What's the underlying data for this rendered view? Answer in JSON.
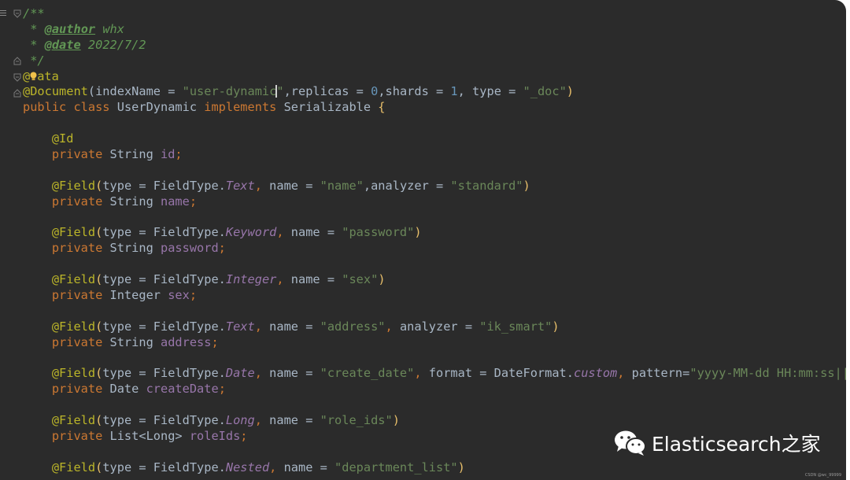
{
  "editor": {
    "language": "java",
    "theme_colors": {
      "background": "#2b2b2b",
      "default_text": "#a9b7c6",
      "keyword": "#cc7832",
      "annotation": "#bbb529",
      "string": "#6a8759",
      "number": "#6897bb",
      "field": "#9876aa",
      "doc_comment": "#629755"
    },
    "lines": [
      {
        "tokens": [
          {
            "t": "/**",
            "c": "doc"
          }
        ]
      },
      {
        "tokens": [
          {
            "t": " * ",
            "c": "doc"
          },
          {
            "t": "@author",
            "c": "doctag"
          },
          {
            "t": " whx",
            "c": "doc"
          }
        ]
      },
      {
        "tokens": [
          {
            "t": " * ",
            "c": "doc"
          },
          {
            "t": "@date",
            "c": "doctag"
          },
          {
            "t": " 2022/7/2",
            "c": "doc"
          }
        ]
      },
      {
        "tokens": [
          {
            "t": " */",
            "c": "doc"
          }
        ]
      },
      {
        "tokens": [
          {
            "t": "@",
            "c": "ann"
          },
          {
            "t": "",
            "c": "bulb"
          },
          {
            "t": "ata",
            "c": "ann"
          }
        ]
      },
      {
        "tokens": [
          {
            "t": "@Document",
            "c": "ann"
          },
          {
            "t": "(indexName = ",
            "c": "param"
          },
          {
            "t": "\"user-dynamic",
            "c": "str"
          },
          {
            "t": "",
            "c": "cursor"
          },
          {
            "t": "\"",
            "c": "str"
          },
          {
            "t": ",replicas = ",
            "c": "param"
          },
          {
            "t": "0",
            "c": "num"
          },
          {
            "t": ",shards = ",
            "c": "param"
          },
          {
            "t": "1",
            "c": "num"
          },
          {
            "t": ", type = ",
            "c": "param"
          },
          {
            "t": "\"_doc\"",
            "c": "str"
          },
          {
            "t": ")",
            "c": "brace"
          }
        ]
      },
      {
        "tokens": [
          {
            "t": "public class ",
            "c": "kw"
          },
          {
            "t": "UserDynamic ",
            "c": "param"
          },
          {
            "t": "implements ",
            "c": "kw"
          },
          {
            "t": "Serializable ",
            "c": "param"
          },
          {
            "t": "{",
            "c": "brace"
          }
        ]
      },
      {
        "tokens": []
      },
      {
        "tokens": [
          {
            "t": "    @Id",
            "c": "ann"
          }
        ]
      },
      {
        "tokens": [
          {
            "t": "    private ",
            "c": "kw"
          },
          {
            "t": "String ",
            "c": "param"
          },
          {
            "t": "id",
            "c": "field"
          },
          {
            "t": ";",
            "c": "kw"
          }
        ]
      },
      {
        "tokens": []
      },
      {
        "tokens": [
          {
            "t": "    @Field",
            "c": "ann"
          },
          {
            "t": "(",
            "c": "brace"
          },
          {
            "t": "type = FieldType.",
            "c": "param"
          },
          {
            "t": "Text",
            "c": "enum"
          },
          {
            "t": ", ",
            "c": "kw"
          },
          {
            "t": "name = ",
            "c": "param"
          },
          {
            "t": "\"name\"",
            "c": "str"
          },
          {
            "t": ",analyzer = ",
            "c": "param"
          },
          {
            "t": "\"standard\"",
            "c": "str"
          },
          {
            "t": ")",
            "c": "brace"
          }
        ]
      },
      {
        "tokens": [
          {
            "t": "    private ",
            "c": "kw"
          },
          {
            "t": "String ",
            "c": "param"
          },
          {
            "t": "name",
            "c": "field"
          },
          {
            "t": ";",
            "c": "kw"
          }
        ]
      },
      {
        "tokens": []
      },
      {
        "tokens": [
          {
            "t": "    @Field",
            "c": "ann"
          },
          {
            "t": "(",
            "c": "brace"
          },
          {
            "t": "type = FieldType.",
            "c": "param"
          },
          {
            "t": "Keyword",
            "c": "enum"
          },
          {
            "t": ", ",
            "c": "kw"
          },
          {
            "t": "name = ",
            "c": "param"
          },
          {
            "t": "\"password\"",
            "c": "str"
          },
          {
            "t": ")",
            "c": "brace"
          }
        ]
      },
      {
        "tokens": [
          {
            "t": "    private ",
            "c": "kw"
          },
          {
            "t": "String ",
            "c": "param"
          },
          {
            "t": "password",
            "c": "field"
          },
          {
            "t": ";",
            "c": "kw"
          }
        ]
      },
      {
        "tokens": []
      },
      {
        "tokens": [
          {
            "t": "    @Field",
            "c": "ann"
          },
          {
            "t": "(",
            "c": "brace"
          },
          {
            "t": "type = FieldType.",
            "c": "param"
          },
          {
            "t": "Integer",
            "c": "enum"
          },
          {
            "t": ", ",
            "c": "kw"
          },
          {
            "t": "name = ",
            "c": "param"
          },
          {
            "t": "\"sex\"",
            "c": "str"
          },
          {
            "t": ")",
            "c": "brace"
          }
        ]
      },
      {
        "tokens": [
          {
            "t": "    private ",
            "c": "kw"
          },
          {
            "t": "Integer ",
            "c": "param"
          },
          {
            "t": "sex",
            "c": "field"
          },
          {
            "t": ";",
            "c": "kw"
          }
        ]
      },
      {
        "tokens": []
      },
      {
        "tokens": [
          {
            "t": "    @Field",
            "c": "ann"
          },
          {
            "t": "(",
            "c": "brace"
          },
          {
            "t": "type = FieldType.",
            "c": "param"
          },
          {
            "t": "Text",
            "c": "enum"
          },
          {
            "t": ", ",
            "c": "kw"
          },
          {
            "t": "name = ",
            "c": "param"
          },
          {
            "t": "\"address\"",
            "c": "str"
          },
          {
            "t": ", ",
            "c": "kw"
          },
          {
            "t": "analyzer = ",
            "c": "param"
          },
          {
            "t": "\"ik_smart\"",
            "c": "str"
          },
          {
            "t": ")",
            "c": "brace"
          }
        ]
      },
      {
        "tokens": [
          {
            "t": "    private ",
            "c": "kw"
          },
          {
            "t": "String ",
            "c": "param"
          },
          {
            "t": "address",
            "c": "field"
          },
          {
            "t": ";",
            "c": "kw"
          }
        ]
      },
      {
        "tokens": []
      },
      {
        "tokens": [
          {
            "t": "    @Field",
            "c": "ann"
          },
          {
            "t": "(",
            "c": "brace"
          },
          {
            "t": "type = FieldType.",
            "c": "param"
          },
          {
            "t": "Date",
            "c": "enum"
          },
          {
            "t": ", ",
            "c": "kw"
          },
          {
            "t": "name = ",
            "c": "param"
          },
          {
            "t": "\"create_date\"",
            "c": "str"
          },
          {
            "t": ", ",
            "c": "kw"
          },
          {
            "t": "format = DateFormat.",
            "c": "param"
          },
          {
            "t": "custom",
            "c": "enum"
          },
          {
            "t": ", ",
            "c": "kw"
          },
          {
            "t": "pattern=",
            "c": "param"
          },
          {
            "t": "\"yyyy-MM-dd HH:mm:ss||stric",
            "c": "str"
          }
        ]
      },
      {
        "tokens": [
          {
            "t": "    private ",
            "c": "kw"
          },
          {
            "t": "Date ",
            "c": "param"
          },
          {
            "t": "createDate",
            "c": "field"
          },
          {
            "t": ";",
            "c": "kw"
          }
        ]
      },
      {
        "tokens": []
      },
      {
        "tokens": [
          {
            "t": "    @Field",
            "c": "ann"
          },
          {
            "t": "(",
            "c": "brace"
          },
          {
            "t": "type = FieldType.",
            "c": "param"
          },
          {
            "t": "Long",
            "c": "enum"
          },
          {
            "t": ", ",
            "c": "kw"
          },
          {
            "t": "name = ",
            "c": "param"
          },
          {
            "t": "\"role_ids\"",
            "c": "str"
          },
          {
            "t": ")",
            "c": "brace"
          }
        ]
      },
      {
        "tokens": [
          {
            "t": "    private ",
            "c": "kw"
          },
          {
            "t": "List<Long> ",
            "c": "param"
          },
          {
            "t": "roleIds",
            "c": "field"
          },
          {
            "t": ";",
            "c": "kw"
          }
        ]
      },
      {
        "tokens": []
      },
      {
        "tokens": [
          {
            "t": "    @Field",
            "c": "ann"
          },
          {
            "t": "(",
            "c": "brace"
          },
          {
            "t": "type = FieldType.",
            "c": "param"
          },
          {
            "t": "Nested",
            "c": "enum"
          },
          {
            "t": ", ",
            "c": "kw"
          },
          {
            "t": "name = ",
            "c": "param"
          },
          {
            "t": "\"department_list\"",
            "c": "str"
          },
          {
            "t": ")",
            "c": "brace"
          }
        ]
      }
    ]
  },
  "watermark": {
    "text": "Elasticsearch之家",
    "icon": "wechat-icon"
  },
  "credit": {
    "text": "CSDN @wc_99999"
  },
  "gutter": {
    "icon": "menu-icon",
    "fold_icon": "fold-marker-icon"
  }
}
